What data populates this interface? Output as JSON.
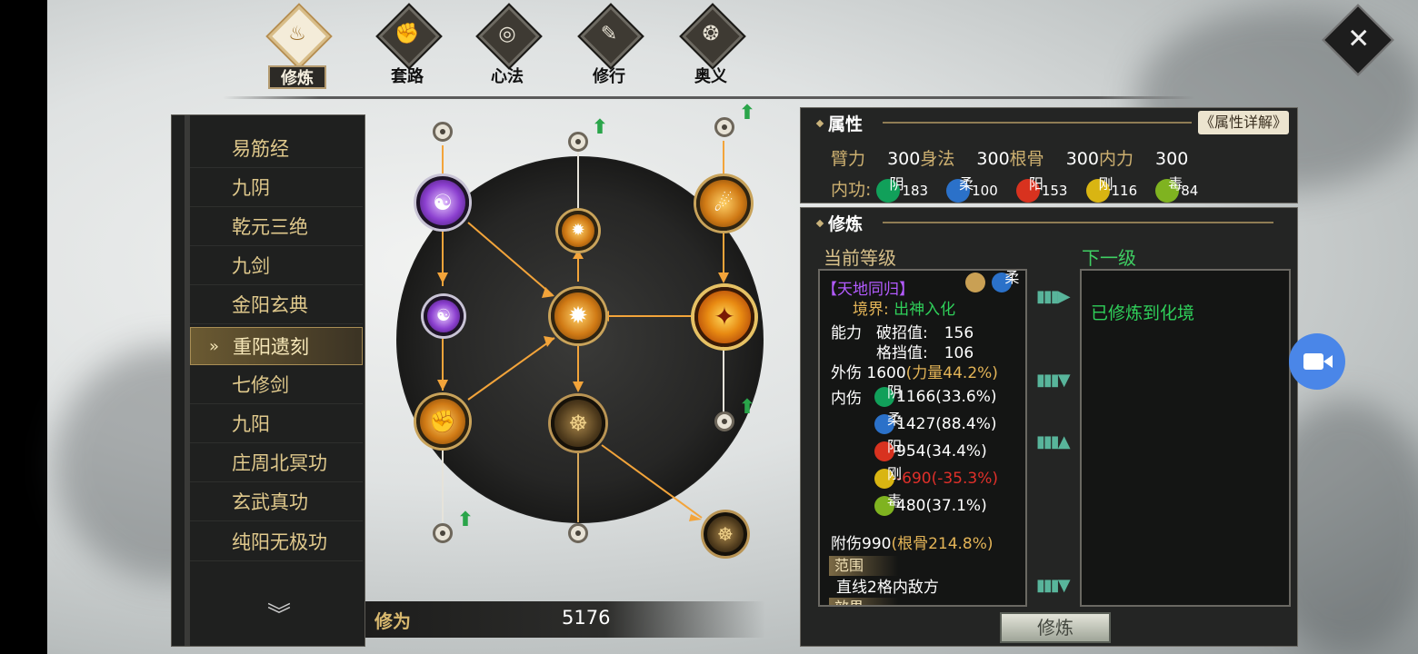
{
  "tabs": [
    {
      "label": "修炼",
      "icon": "flame-icon",
      "active": true
    },
    {
      "label": "套路",
      "icon": "fist-icon",
      "active": false
    },
    {
      "label": "心法",
      "icon": "swirl-icon",
      "active": false
    },
    {
      "label": "修行",
      "icon": "scroll-icon",
      "active": false
    },
    {
      "label": "奥义",
      "icon": "spiral-flame-icon",
      "active": false
    }
  ],
  "sidebar": {
    "items": [
      "易筋经",
      "九阴",
      "乾元三绝",
      "九剑",
      "金阳玄典",
      "重阳遗刻",
      "七修剑",
      "九阳",
      "庄周北冥功",
      "玄武真功",
      "纯阳无极功"
    ],
    "selected_index": 5,
    "selected_marker": "»"
  },
  "cultivation_points": {
    "label": "修为",
    "value": "5176"
  },
  "attributes": {
    "title": "属性",
    "detail_button": "《属性详解》",
    "stats": [
      {
        "name": "臂力",
        "value": "300"
      },
      {
        "name": "身法",
        "value": "300"
      },
      {
        "name": "根骨",
        "value": "300"
      },
      {
        "name": "内力",
        "value": "300"
      }
    ],
    "neigong_label": "内功:",
    "neigong": [
      {
        "elem": "阴",
        "value": "183"
      },
      {
        "elem": "柔",
        "value": "100"
      },
      {
        "elem": "阳",
        "value": "153"
      },
      {
        "elem": "刚",
        "value": "116"
      },
      {
        "elem": "毒",
        "value": "84"
      }
    ]
  },
  "cultivation": {
    "title": "修炼",
    "current_label": "当前等级",
    "next_label": "下一级",
    "skill_name": "【天地同归】",
    "skill_elem": "柔",
    "realm_label": "境界:",
    "realm_value": "出神入化",
    "ability_label": "能力",
    "break_label": "破招值:",
    "break_value": "156",
    "block_label": "格挡值:",
    "block_value": "106",
    "outer_label": "外伤",
    "outer_value": "1600",
    "outer_note": "(力量44.2%)",
    "inner_label": "内伤",
    "inner": [
      {
        "elem": "阴",
        "text": "1166(33.6%)",
        "negative": false
      },
      {
        "elem": "柔",
        "text": "1427(88.4%)",
        "negative": false
      },
      {
        "elem": "阳",
        "text": "954(34.4%)",
        "negative": false
      },
      {
        "elem": "刚",
        "text": "-690(-35.3%)",
        "negative": true
      },
      {
        "elem": "毒",
        "text": "480(37.1%)",
        "negative": false
      }
    ],
    "extra_label": "附伤990",
    "extra_note": "(根骨214.8%)",
    "range_tag": "范围",
    "range_text": "直线2格内敌方",
    "effect_tag": "效果",
    "next_text": "已修炼到化境",
    "button": "修炼"
  },
  "colors": {
    "accent_gold": "#d8b86e",
    "green": "#2fd05a",
    "purple": "#b35bff",
    "negative": "#e0302a"
  }
}
